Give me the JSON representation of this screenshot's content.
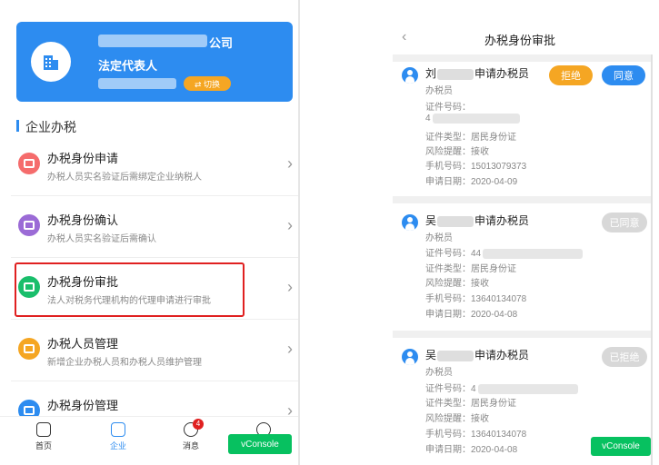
{
  "left": {
    "company": {
      "suffix": "公司",
      "role": "法定代表人",
      "switch_label": "⇄ 切换"
    },
    "section_title": "企业办税",
    "menu": [
      {
        "title": "办税身份申请",
        "desc": "办税人员实名验证后需绑定企业纳税人",
        "color": "#f56c6c",
        "icon": "id-card-icon"
      },
      {
        "title": "办税身份确认",
        "desc": "办税人员实名验证后需确认",
        "color": "#9b6bd6",
        "icon": "clipboard-icon"
      },
      {
        "title": "办税身份审批",
        "desc": "法人对税务代理机构的代理申请进行审批",
        "color": "#19be6b",
        "icon": "approval-card-icon"
      },
      {
        "title": "办税人员管理",
        "desc": "新增企业办税人员和办税人员维护管理",
        "color": "#f5a623",
        "icon": "person-icon"
      },
      {
        "title": "办税身份管理",
        "desc": "",
        "color": "#2d8cf0",
        "icon": "identity-icon"
      }
    ],
    "tabs": [
      {
        "label": "首页",
        "icon": "home-icon"
      },
      {
        "label": "企业",
        "icon": "enterprise-icon"
      },
      {
        "label": "消息",
        "icon": "message-icon",
        "badge": "4"
      },
      {
        "label": "",
        "icon": "my-icon"
      }
    ],
    "vconsole": "vConsole"
  },
  "right": {
    "back_icon": "chevron-left-icon",
    "title": "办税身份审批",
    "records": [
      {
        "name_prefix": "刘",
        "name_suffix": "申请办税员",
        "role": "办税员",
        "cert_label": "证件号码：",
        "cert_value": "4",
        "cert_type": "证件类型：居民身份证",
        "reminder": "风险提醒：接收",
        "phone": "手机号码：15013079373",
        "date": "申请日期：2020-04-09",
        "reject_label": "拒绝",
        "agree_label": "同意"
      },
      {
        "name_prefix": "吴",
        "name_suffix": "申请办税员",
        "role": "办税员",
        "cert_label": "证件号码：",
        "cert_value": "44",
        "cert_type": "证件类型：居民身份证",
        "reminder": "风险提醒：接收",
        "phone": "手机号码：13640134078",
        "date": "申请日期：2020-04-08",
        "status_label": "已同意"
      },
      {
        "name_prefix": "吴",
        "name_suffix": "申请办税员",
        "role": "办税员",
        "cert_label": "证件号码：",
        "cert_value": "4",
        "cert_type": "证件类型：居民身份证",
        "reminder": "风险提醒：接收",
        "phone": "手机号码：13640134078",
        "date": "申请日期：2020-04-08",
        "status_label": "已拒绝"
      }
    ],
    "vconsole": "vConsole"
  }
}
